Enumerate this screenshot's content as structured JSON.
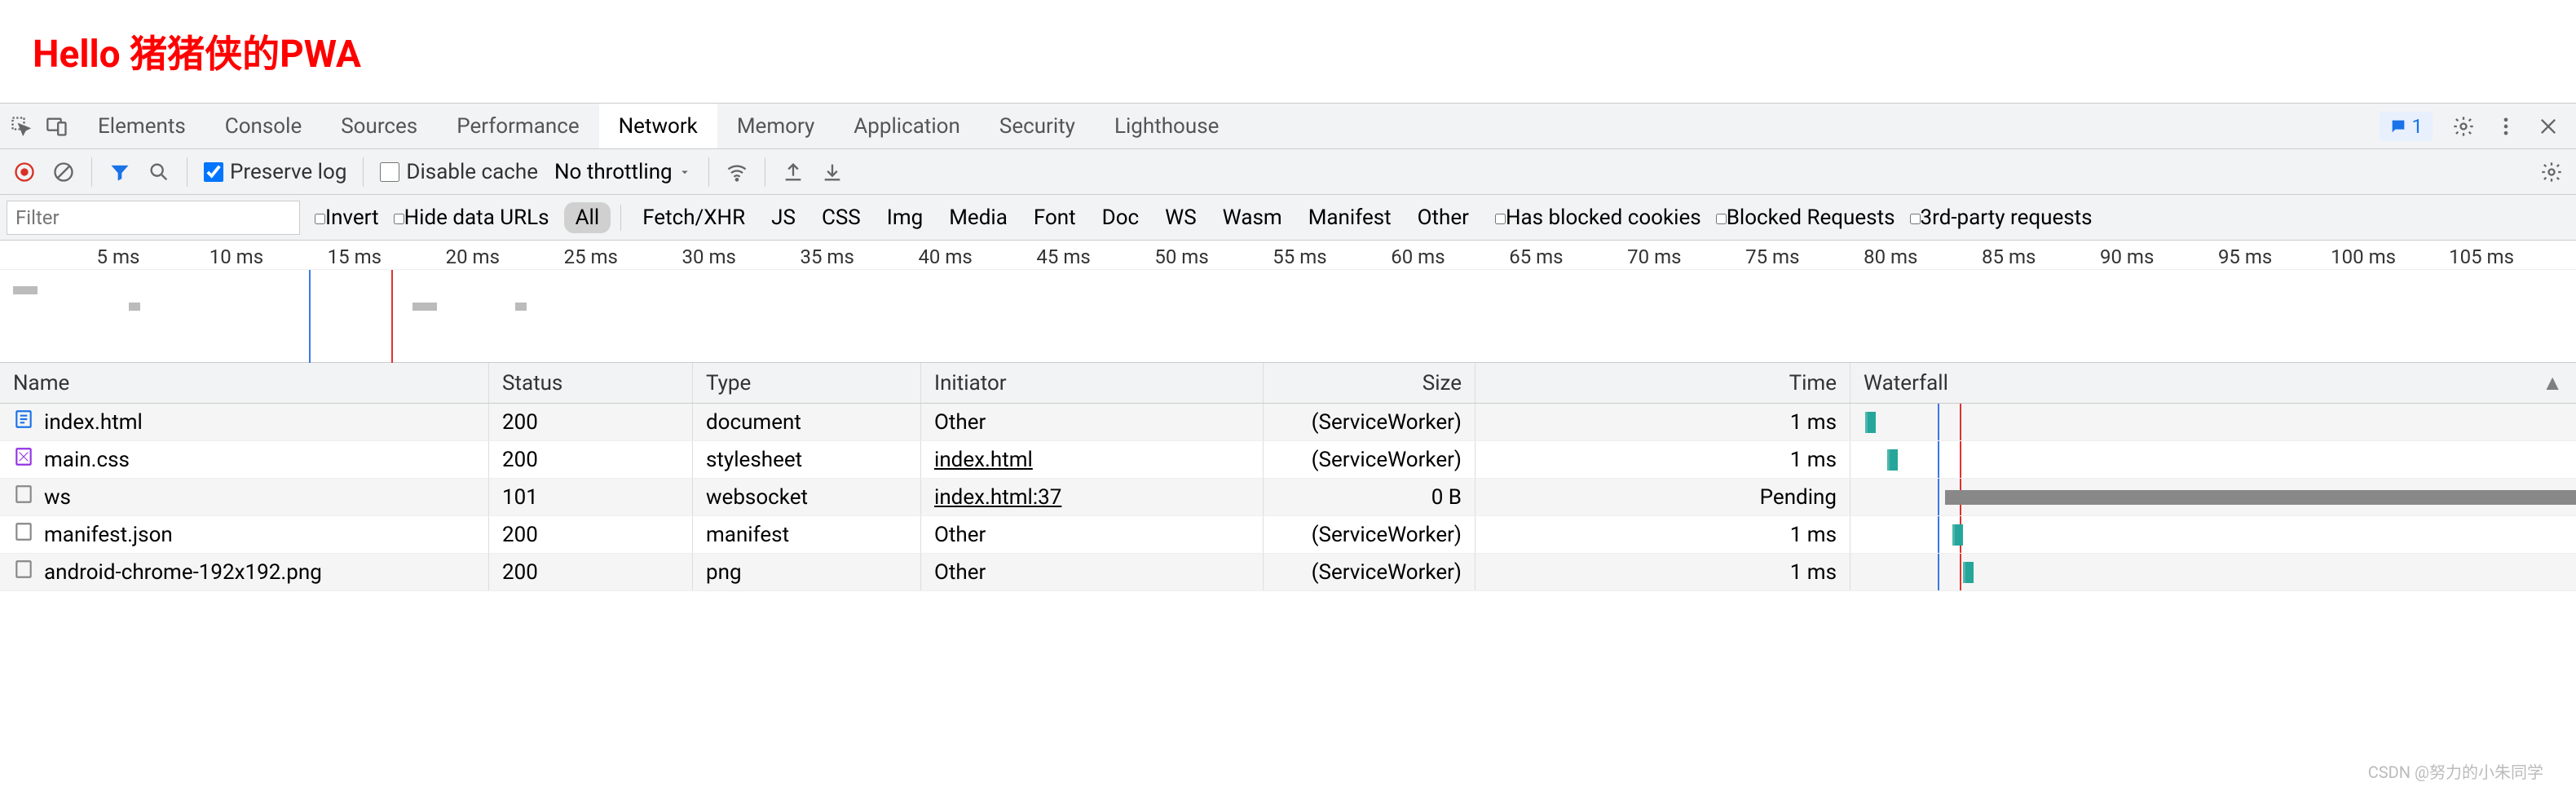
{
  "page": {
    "title": "Hello 猪猪侠的PWA"
  },
  "devtools": {
    "tabs": [
      "Elements",
      "Console",
      "Sources",
      "Performance",
      "Network",
      "Memory",
      "Application",
      "Security",
      "Lighthouse"
    ],
    "active_tab": "Network",
    "issues_count": "1"
  },
  "toolbar": {
    "preserve_log": "Preserve log",
    "disable_cache": "Disable cache",
    "throttling": "No throttling"
  },
  "filter": {
    "placeholder": "Filter",
    "invert": "Invert",
    "hide_data_urls": "Hide data URLs",
    "types": [
      "All",
      "Fetch/XHR",
      "JS",
      "CSS",
      "Img",
      "Media",
      "Font",
      "Doc",
      "WS",
      "Wasm",
      "Manifest",
      "Other"
    ],
    "active_type": "All",
    "has_blocked_cookies": "Has blocked cookies",
    "blocked_requests": "Blocked Requests",
    "third_party": "3rd-party requests"
  },
  "timeline": {
    "ticks": [
      "5 ms",
      "10 ms",
      "15 ms",
      "20 ms",
      "25 ms",
      "30 ms",
      "35 ms",
      "40 ms",
      "45 ms",
      "50 ms",
      "55 ms",
      "60 ms",
      "65 ms",
      "70 ms",
      "75 ms",
      "80 ms",
      "85 ms",
      "90 ms",
      "95 ms",
      "100 ms",
      "105 ms"
    ]
  },
  "table": {
    "headers": {
      "name": "Name",
      "status": "Status",
      "type": "Type",
      "initiator": "Initiator",
      "size": "Size",
      "time": "Time",
      "waterfall": "Waterfall"
    },
    "rows": [
      {
        "icon": "doc",
        "name": "index.html",
        "status": "200",
        "type": "document",
        "initiator": "Other",
        "initiator_link": false,
        "size": "(ServiceWorker)",
        "time": "1 ms",
        "wf_start": 2,
        "wf_len": 1.5,
        "pending": false
      },
      {
        "icon": "css",
        "name": "main.css",
        "status": "200",
        "type": "stylesheet",
        "initiator": "index.html",
        "initiator_link": true,
        "size": "(ServiceWorker)",
        "time": "1 ms",
        "wf_start": 5,
        "wf_len": 1.5,
        "pending": false
      },
      {
        "icon": "empty",
        "name": "ws",
        "status": "101",
        "type": "websocket",
        "initiator": "index.html:37",
        "initiator_link": true,
        "size": "0 B",
        "time": "Pending",
        "wf_start": 13,
        "wf_len": 87,
        "pending": true
      },
      {
        "icon": "empty",
        "name": "manifest.json",
        "status": "200",
        "type": "manifest",
        "initiator": "Other",
        "initiator_link": false,
        "size": "(ServiceWorker)",
        "time": "1 ms",
        "wf_start": 14,
        "wf_len": 1.5,
        "pending": false
      },
      {
        "icon": "empty",
        "name": "android-chrome-192x192.png",
        "status": "200",
        "type": "png",
        "initiator": "Other",
        "initiator_link": false,
        "size": "(ServiceWorker)",
        "time": "1 ms",
        "wf_start": 15.5,
        "wf_len": 1.5,
        "pending": false
      }
    ]
  },
  "watermark": "CSDN @努力的小朱同学"
}
